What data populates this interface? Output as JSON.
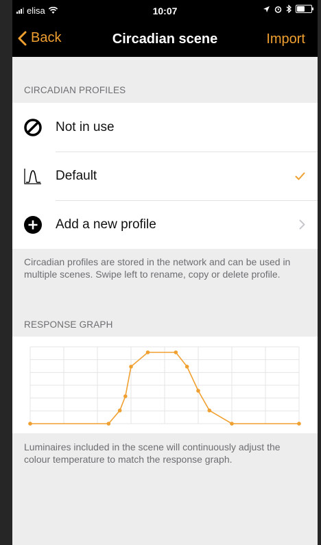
{
  "status_bar": {
    "carrier": "elisa",
    "time": "10:07",
    "battery_level": 0.6,
    "icons": [
      "signal-icon",
      "wifi-icon",
      "location-icon",
      "alarm-icon",
      "bluetooth-icon",
      "battery-icon"
    ]
  },
  "nav": {
    "back_label": "Back",
    "title": "Circadian scene",
    "action_label": "Import"
  },
  "profiles_section": {
    "header": "CIRCADIAN PROFILES",
    "items": [
      {
        "label": "Not in use",
        "icon": "no-entry-icon",
        "accessory": "none"
      },
      {
        "label": "Default",
        "icon": "curve-profile-icon",
        "accessory": "checkmark"
      },
      {
        "label": "Add a new profile",
        "icon": "plus-circle-icon",
        "accessory": "chevron"
      }
    ],
    "footer": "Circadian profiles are stored in the network and can be used in multiple scenes. Swipe left to rename, copy or delete profile."
  },
  "response_section": {
    "header": "RESPONSE GRAPH",
    "footer": "Luminaires included in the scene will continuously adjust the colour temperature to match the response graph."
  },
  "chart_data": {
    "type": "line",
    "x": [
      0,
      7,
      8,
      8.5,
      9,
      10.5,
      13,
      14,
      15,
      16,
      18,
      24
    ],
    "values": [
      0,
      0,
      1.2,
      2.5,
      5.2,
      6.5,
      6.5,
      5.2,
      3,
      1.2,
      0,
      0
    ],
    "xlim": [
      0,
      24
    ],
    "ylim": [
      0,
      7
    ],
    "grid": true,
    "color": "#f0a030"
  },
  "colors": {
    "accent": "#f0a030",
    "background": "#ededed",
    "navbar": "#000000"
  }
}
